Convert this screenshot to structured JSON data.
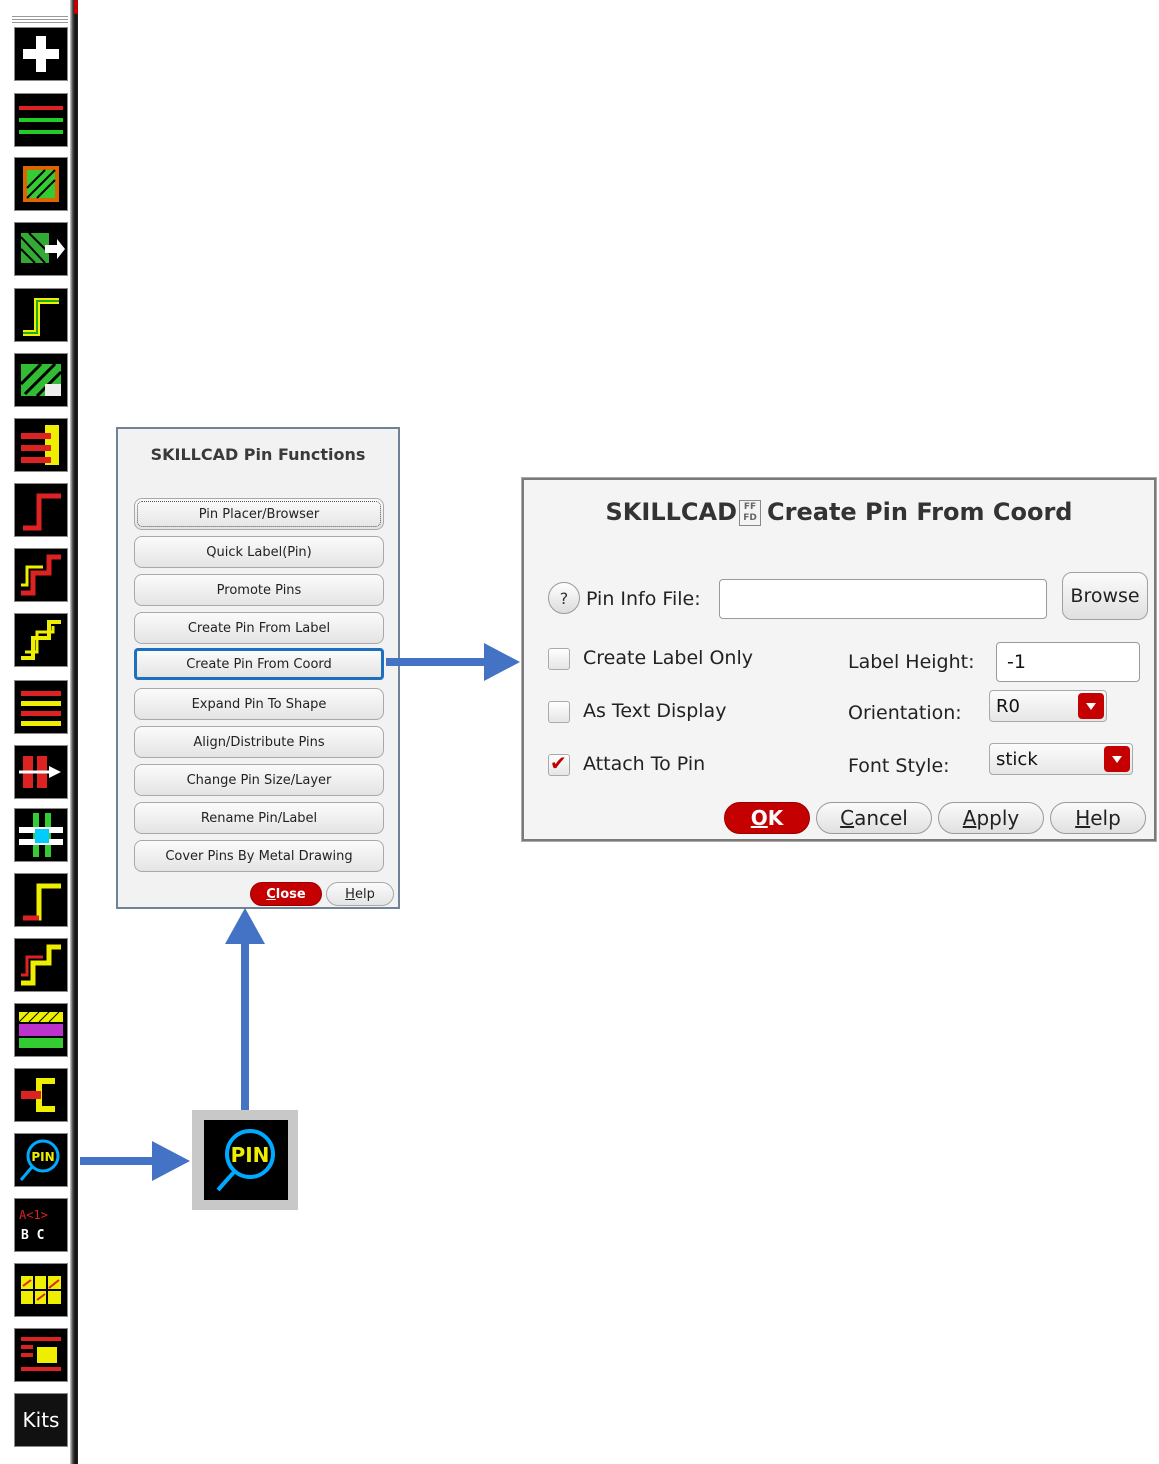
{
  "toolbar": {
    "tools": [
      {
        "name": "add-icon"
      },
      {
        "name": "parallel-lines-icon"
      },
      {
        "name": "fill-shape-icon"
      },
      {
        "name": "shape-move-icon"
      },
      {
        "name": "step-path-icon"
      },
      {
        "name": "hatched-shape-icon"
      },
      {
        "name": "stacked-bars-icon"
      },
      {
        "name": "corner-path-icon"
      },
      {
        "name": "double-step-icon"
      },
      {
        "name": "triple-step-icon"
      },
      {
        "name": "bus-lines-icon"
      },
      {
        "name": "pin-move-icon"
      },
      {
        "name": "cross-grid-icon"
      },
      {
        "name": "corner-path-2-icon"
      },
      {
        "name": "double-step-2-icon"
      },
      {
        "name": "layer-stack-icon"
      },
      {
        "name": "bracket-icon"
      },
      {
        "name": "pin-search-icon"
      },
      {
        "name": "bus-label-icon"
      },
      {
        "name": "grid-pattern-icon"
      },
      {
        "name": "array-pattern-icon"
      },
      {
        "name": "kits-icon"
      }
    ],
    "pin_text": "PIN",
    "bus_text_top": "A<1>",
    "bus_text_bottom": "B C",
    "kits_label": "Kits"
  },
  "pin_functions": {
    "title": "SKILLCAD Pin Functions",
    "buttons": [
      "Pin Placer/Browser",
      "Quick Label(Pin)",
      "Promote Pins",
      "Create Pin From Label",
      "Create Pin From Coord",
      "Expand Pin To Shape",
      "Align/Distribute Pins",
      "Change Pin Size/Layer",
      "Rename Pin/Label",
      "Cover Pins By Metal Drawing"
    ],
    "close_label": "Close",
    "help_label": "Help"
  },
  "create_pin": {
    "title_left": "SKILLCAD",
    "title_icon_text": "FF FD",
    "title_right": "Create Pin From Coord",
    "help_q": "?",
    "pin_info_label": "Pin Info File:",
    "pin_info_value": "",
    "browse_label": "Browse",
    "create_label_only": "Create Label Only",
    "create_label_only_checked": false,
    "as_text_display": "As Text Display",
    "as_text_display_checked": false,
    "attach_to_pin": "Attach To Pin",
    "attach_to_pin_checked": true,
    "label_height_label": "Label Height:",
    "label_height_value": "-1",
    "orientation_label": "Orientation:",
    "orientation_value": "R0",
    "font_style_label": "Font Style:",
    "font_style_value": "stick",
    "ok_label": "OK",
    "cancel_label": "Cancel",
    "apply_label": "Apply",
    "help_label": "Help"
  },
  "zoom": {
    "pin_text": "PIN"
  },
  "colors": {
    "accent_red": "#c40000",
    "selection_blue": "#1f6fbf",
    "arrow_blue": "#4472c4"
  }
}
